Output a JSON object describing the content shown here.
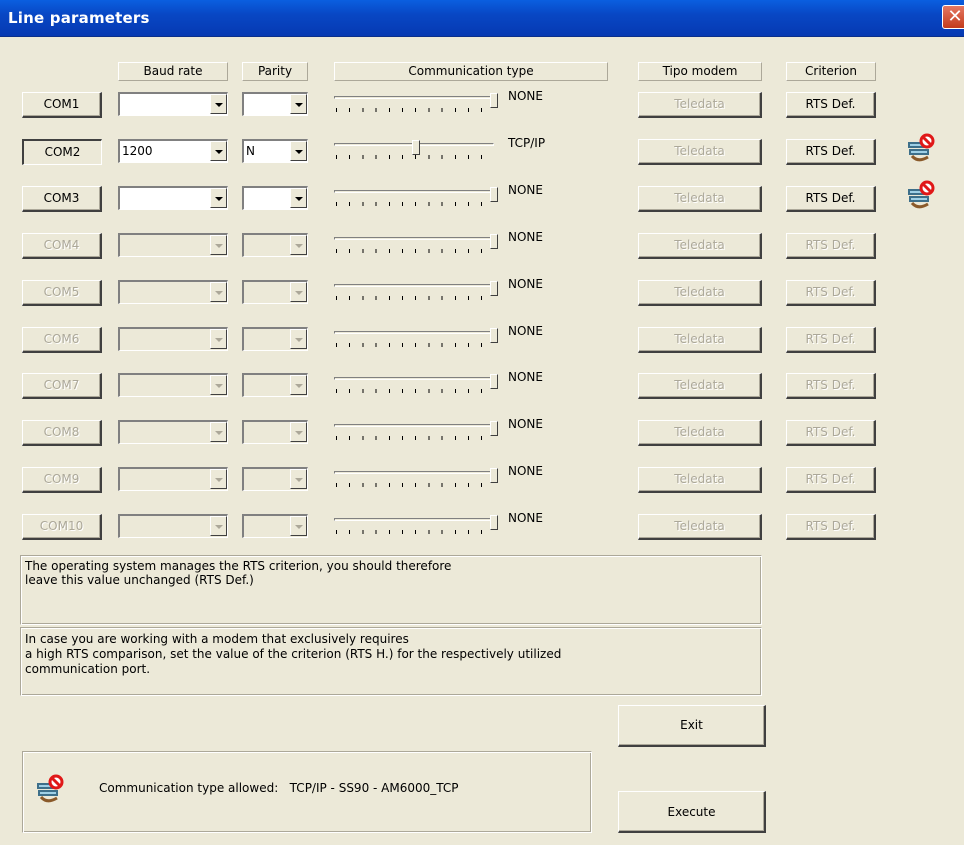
{
  "window": {
    "title": "Line parameters"
  },
  "headers": {
    "baud_rate": "Baud rate",
    "parity": "Parity",
    "communication_type": "Communication type",
    "tipo_modem": "Tipo modem",
    "criterion": "Criterion"
  },
  "rows": [
    {
      "port": "COM1",
      "enabled": true,
      "baud": "",
      "parity": "",
      "slider_level": 1.0,
      "comm": "NONE",
      "modem": "Teledata",
      "criterion": "RTS Def.",
      "blocked_icon": false
    },
    {
      "port": "COM2",
      "enabled": true,
      "baud": "1200",
      "parity": "N",
      "slider_level": 0.5,
      "comm": "TCP/IP",
      "modem": "Teledata",
      "criterion": "RTS Def.",
      "blocked_icon": true
    },
    {
      "port": "COM3",
      "enabled": true,
      "baud": "",
      "parity": "",
      "slider_level": 1.0,
      "comm": "NONE",
      "modem": "Teledata",
      "criterion": "RTS Def.",
      "blocked_icon": true
    },
    {
      "port": "COM4",
      "enabled": false,
      "baud": "",
      "parity": "",
      "slider_level": 1.0,
      "comm": "NONE",
      "modem": "Teledata",
      "criterion": "RTS Def.",
      "blocked_icon": false
    },
    {
      "port": "COM5",
      "enabled": false,
      "baud": "",
      "parity": "",
      "slider_level": 1.0,
      "comm": "NONE",
      "modem": "Teledata",
      "criterion": "RTS Def.",
      "blocked_icon": false
    },
    {
      "port": "COM6",
      "enabled": false,
      "baud": "",
      "parity": "",
      "slider_level": 1.0,
      "comm": "NONE",
      "modem": "Teledata",
      "criterion": "RTS Def.",
      "blocked_icon": false
    },
    {
      "port": "COM7",
      "enabled": false,
      "baud": "",
      "parity": "",
      "slider_level": 1.0,
      "comm": "NONE",
      "modem": "Teledata",
      "criterion": "RTS Def.",
      "blocked_icon": false
    },
    {
      "port": "COM8",
      "enabled": false,
      "baud": "",
      "parity": "",
      "slider_level": 1.0,
      "comm": "NONE",
      "modem": "Teledata",
      "criterion": "RTS Def.",
      "blocked_icon": false
    },
    {
      "port": "COM9",
      "enabled": false,
      "baud": "",
      "parity": "",
      "slider_level": 1.0,
      "comm": "NONE",
      "modem": "Teledata",
      "criterion": "RTS Def.",
      "blocked_icon": false
    },
    {
      "port": "COM10",
      "enabled": false,
      "baud": "",
      "parity": "",
      "slider_level": 1.0,
      "comm": "NONE",
      "modem": "Teledata",
      "criterion": "RTS Def.",
      "blocked_icon": false
    }
  ],
  "info": {
    "rts_line1": "The operating system manages the RTS criterion, you should therefore",
    "rts_line2": "leave this value unchanged (RTS Def.)",
    "modem_line1": "In case you are working with a modem that exclusively requires",
    "modem_line2": "a high RTS comparison, set the value of the criterion (RTS H.) for the respectively utilized",
    "modem_line3": "communication port."
  },
  "footer": {
    "allowed_text": "Communication type allowed:   TCP/IP - SS90 - AM6000_TCP",
    "exit_label": "Exit",
    "execute_label": "Execute"
  },
  "colors": {
    "title_bar": "#0847c4",
    "close_button": "#d24a2c",
    "face": "#ece9d8",
    "disabled_text": "#aca899"
  }
}
